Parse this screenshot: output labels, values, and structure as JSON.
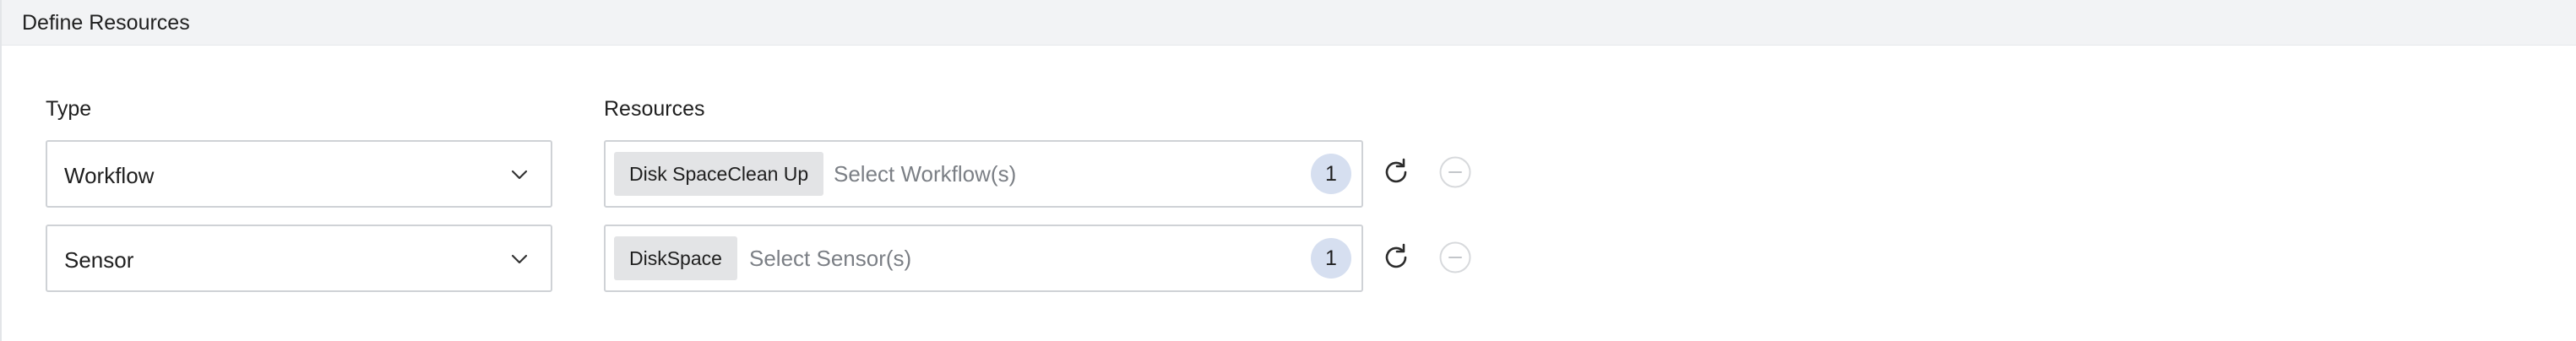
{
  "panel": {
    "title": "Define Resources"
  },
  "columns": {
    "type_label": "Type",
    "resources_label": "Resources"
  },
  "rows": [
    {
      "type_value": "Workflow",
      "chip": "Disk SpaceClean Up",
      "placeholder": "Select Workflow(s)",
      "count": "1",
      "refresh_icon": "refresh-icon",
      "remove_icon": "minus-circle-icon"
    },
    {
      "type_value": "Sensor",
      "chip": "DiskSpace",
      "placeholder": "Select Sensor(s)",
      "count": "1",
      "refresh_icon": "refresh-icon",
      "remove_icon": "minus-circle-icon"
    }
  ],
  "colors": {
    "header_bg": "#f2f3f5",
    "border": "#cfd2d6",
    "chip_bg": "#e3e4e6",
    "badge_bg": "#d6dff0",
    "placeholder": "#7b7f85"
  }
}
